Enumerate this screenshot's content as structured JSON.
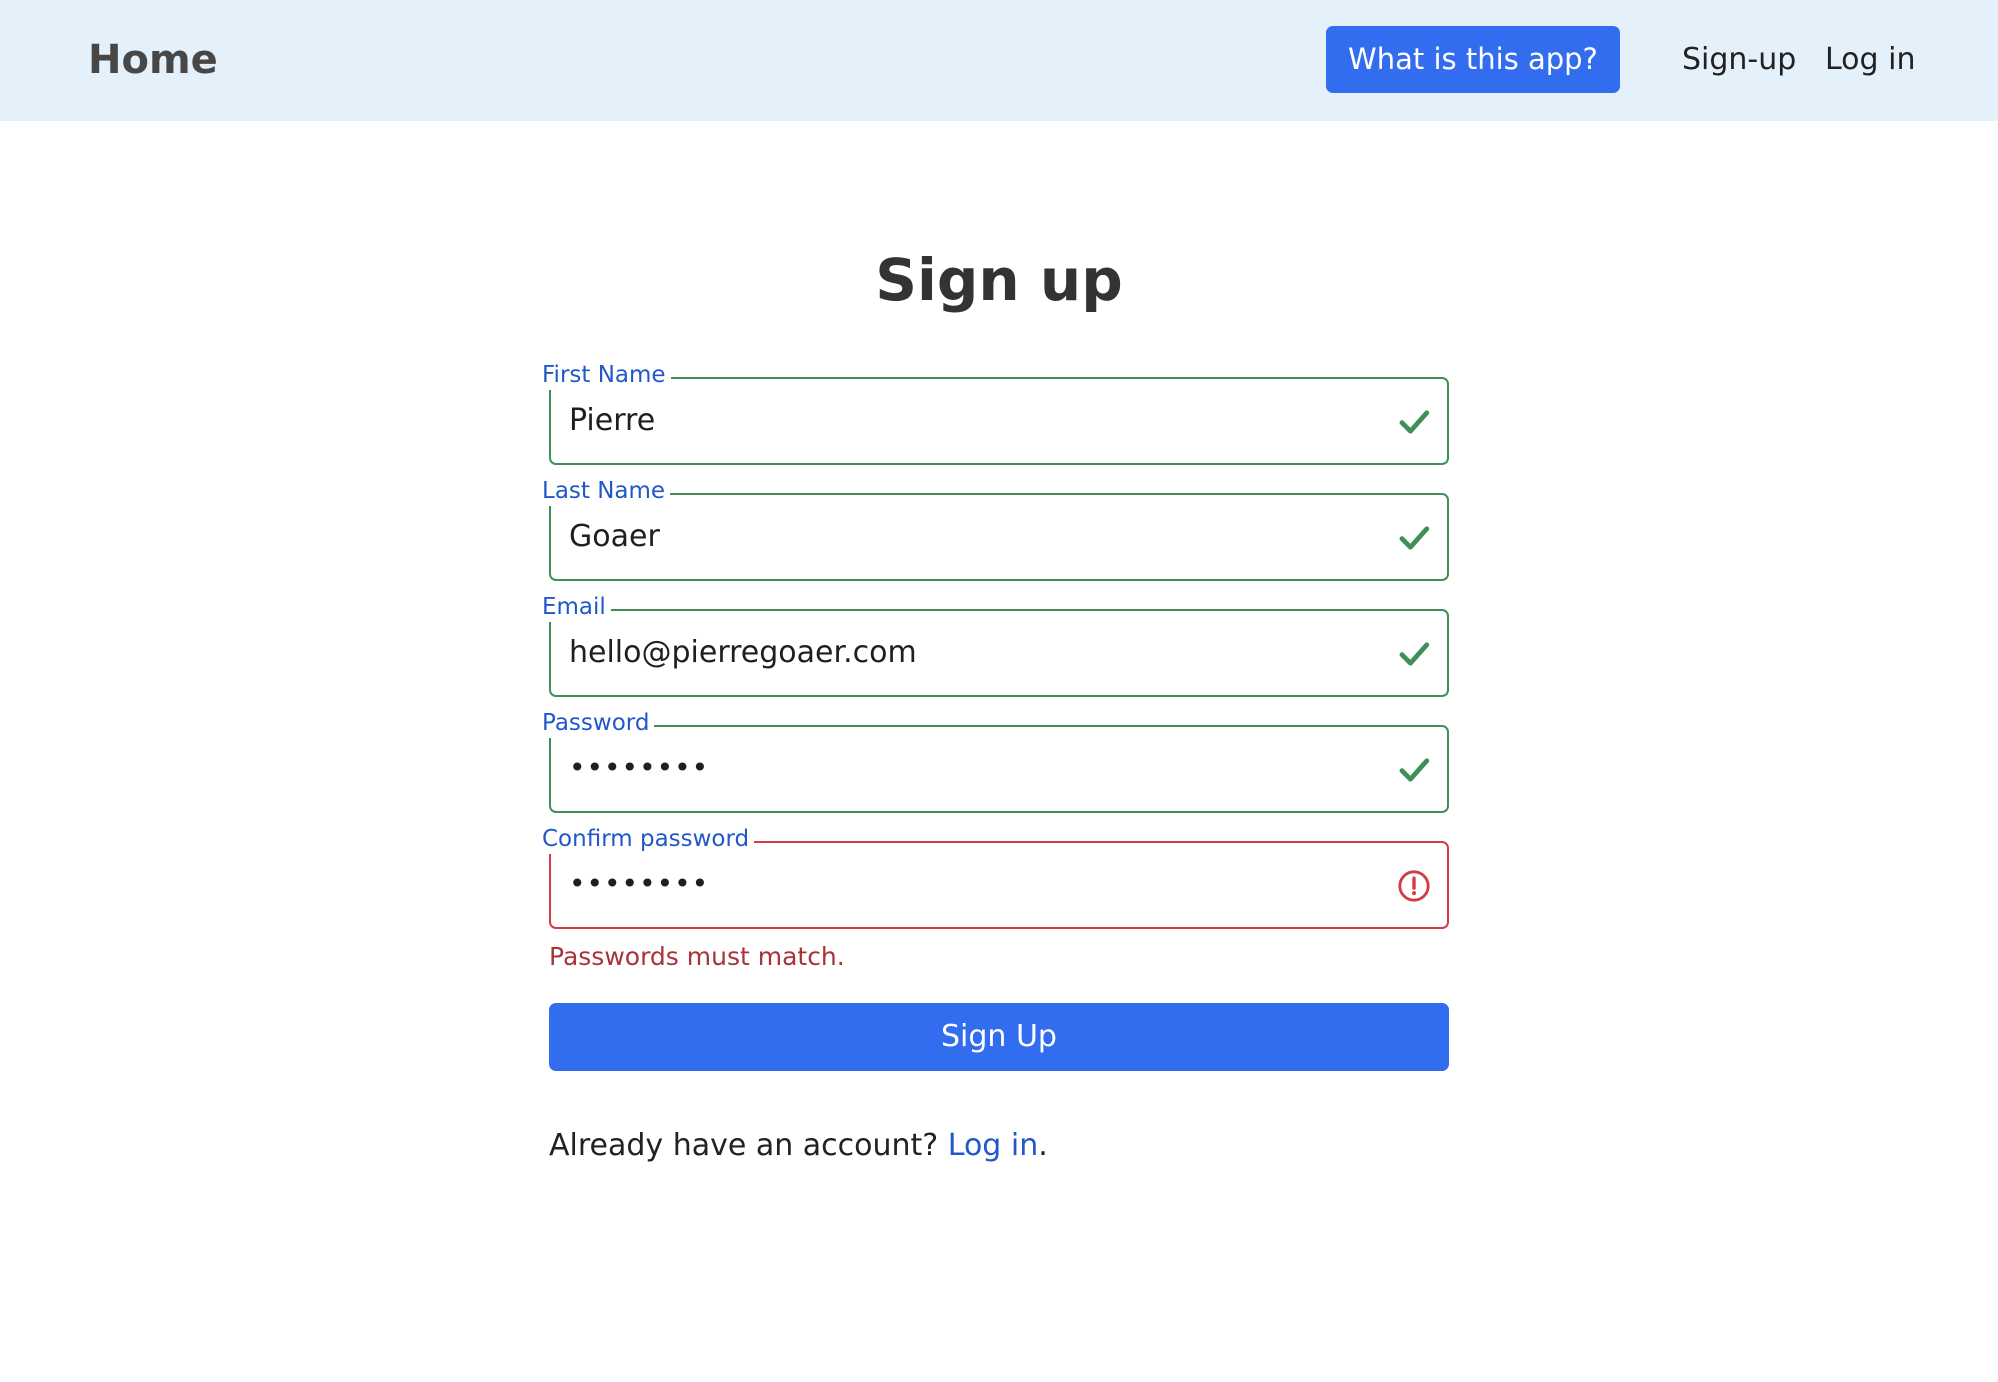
{
  "navbar": {
    "brand": "Home",
    "about_button": "What is this app?",
    "links": [
      "Sign-up",
      "Log in"
    ]
  },
  "form": {
    "title": "Sign up",
    "fields": [
      {
        "label": "First Name",
        "value": "Pierre",
        "status": "valid",
        "icon": "checkmark-icon"
      },
      {
        "label": "Last Name",
        "value": "Goaer",
        "status": "valid",
        "icon": "checkmark-icon"
      },
      {
        "label": "Email",
        "value": "hello@pierregoaer.com",
        "status": "valid",
        "icon": "checkmark-icon"
      },
      {
        "label": "Password",
        "value": "••••••••",
        "status": "valid",
        "icon": "checkmark-icon"
      },
      {
        "label": "Confirm password",
        "value": "••••••••",
        "status": "invalid",
        "icon": "error-circle-icon"
      }
    ],
    "error_message": "Passwords must match.",
    "submit_label": "Sign Up",
    "footer": {
      "prefix": "Already have an account? ",
      "link": "Log in",
      "suffix": "."
    }
  },
  "colors": {
    "navbar_bg": "#e4f0fa",
    "primary": "#326df0",
    "valid": "#3f8f57",
    "invalid": "#d33c46",
    "label": "#2158c9"
  }
}
